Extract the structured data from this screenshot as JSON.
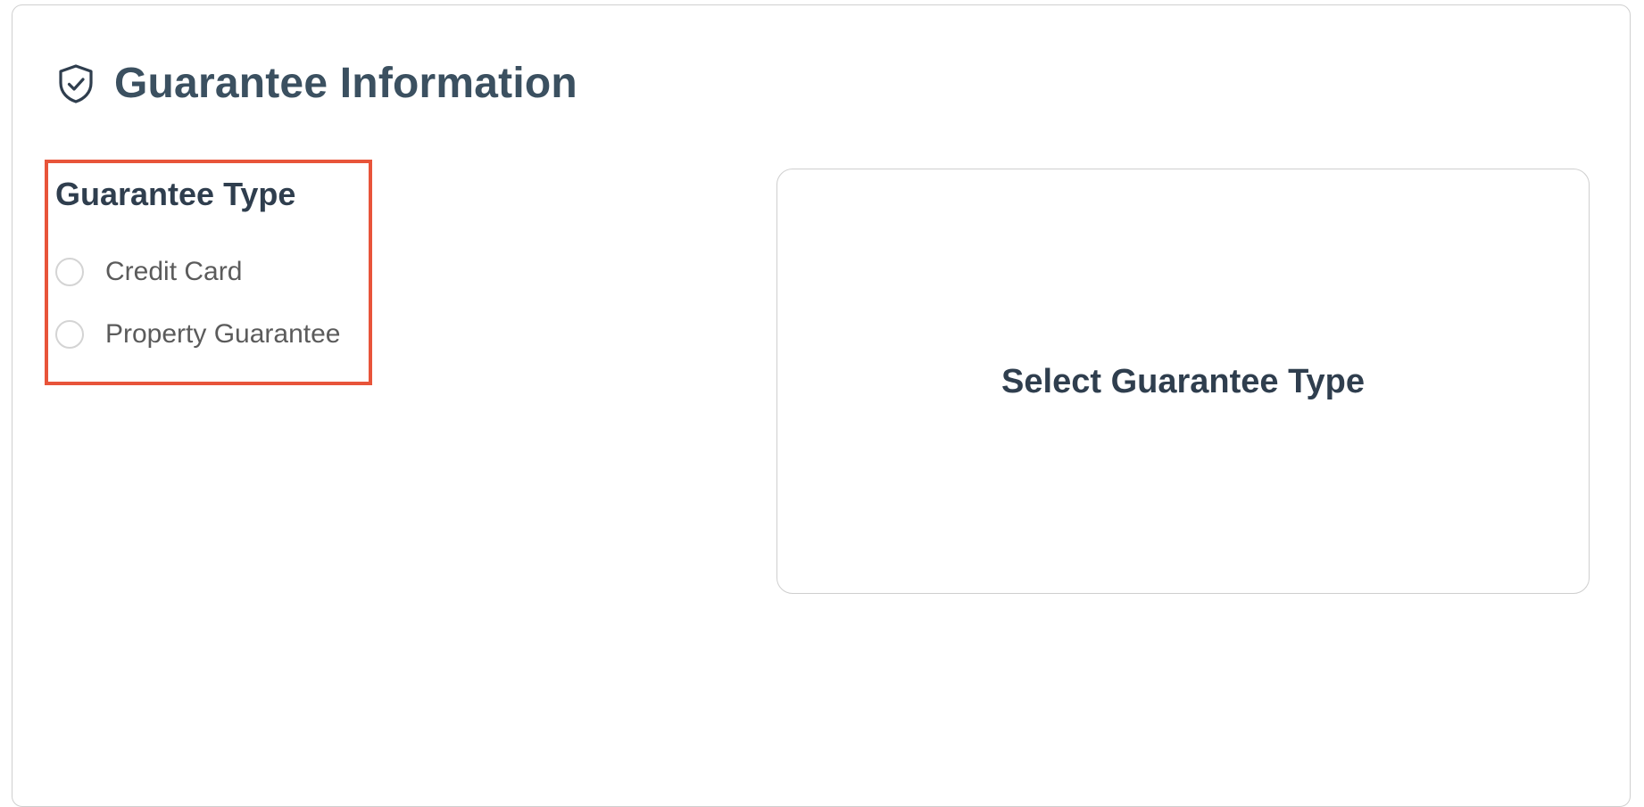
{
  "header": {
    "title": "Guarantee Information",
    "icon": "shield-check-icon"
  },
  "guarantee_type": {
    "label": "Guarantee Type",
    "options": [
      {
        "label": "Credit Card",
        "selected": false
      },
      {
        "label": "Property Guarantee",
        "selected": false
      }
    ]
  },
  "detail_panel": {
    "placeholder": "Select Guarantee Type"
  },
  "colors": {
    "title": "#3b5060",
    "heading": "#2f3e4e",
    "highlight_border": "#e8543a",
    "card_border": "#cfcfcf"
  }
}
